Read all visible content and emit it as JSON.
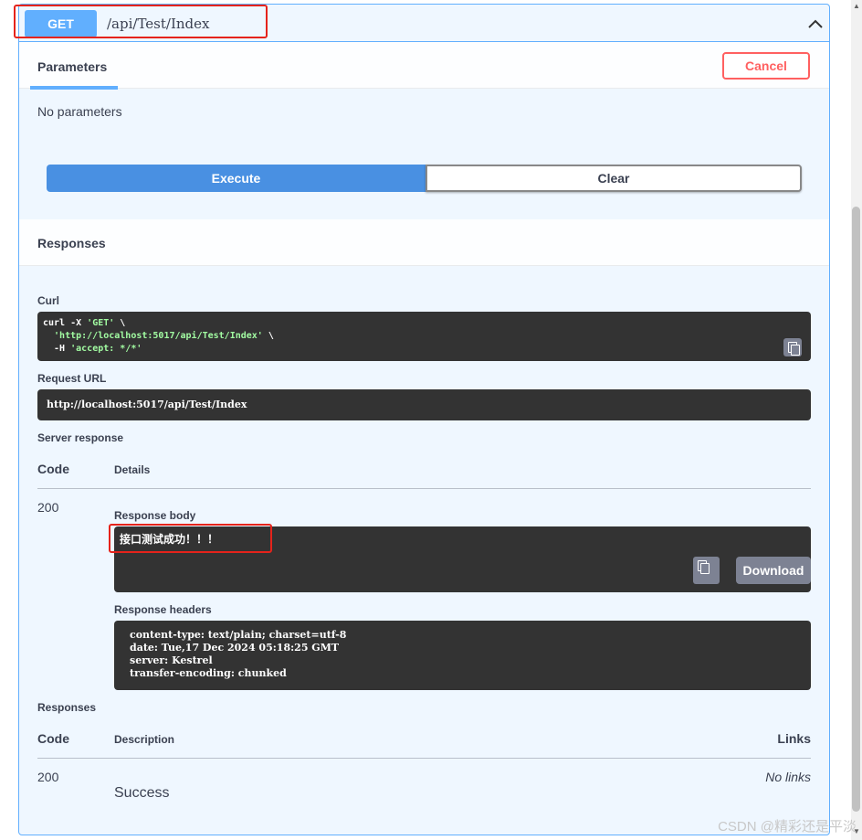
{
  "operation": {
    "method": "GET",
    "path": "/api/Test/Index"
  },
  "parameters": {
    "tab_label": "Parameters",
    "cancel_label": "Cancel",
    "empty_text": "No parameters"
  },
  "actions": {
    "execute_label": "Execute",
    "clear_label": "Clear"
  },
  "responses_header": "Responses",
  "curl": {
    "label": "Curl",
    "line1_prefix": "curl -X ",
    "line1_str": "'GET'",
    "line1_suffix": " \\",
    "line2_str": "  'http://localhost:5017/api/Test/Index'",
    "line2_suffix": " \\",
    "line3_prefix": "  -H ",
    "line3_str": "'accept: */*'"
  },
  "request_url": {
    "label": "Request URL",
    "value": "http://localhost:5017/api/Test/Index"
  },
  "server_response": {
    "label": "Server response",
    "code_header": "Code",
    "details_header": "Details",
    "code": "200",
    "body_label": "Response body",
    "body": "接口测试成功！！！",
    "download_label": "Download",
    "headers_label": "Response headers",
    "headers": [
      "content-type: text/plain; charset=utf-8",
      "date: Tue,17 Dec 2024 05:18:25 GMT",
      "server: Kestrel",
      "transfer-encoding: chunked"
    ]
  },
  "responses": {
    "label": "Responses",
    "code_header": "Code",
    "description_header": "Description",
    "links_header": "Links",
    "rows": [
      {
        "code": "200",
        "description": "Success",
        "links": "No links"
      }
    ]
  },
  "watermark": "CSDN @精彩还是平淡",
  "colors": {
    "get_blue": "#61affe",
    "execute_blue": "#4990e2",
    "cancel_red": "#ff6060",
    "code_bg": "#333333",
    "annotation_red": "#e5231b"
  }
}
